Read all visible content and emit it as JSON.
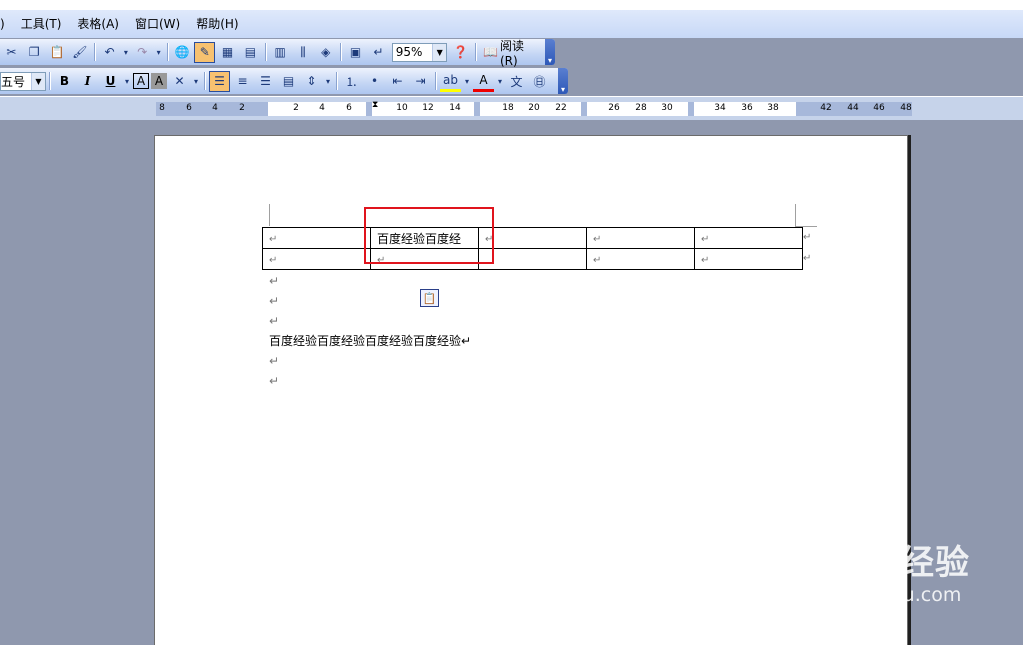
{
  "menu": {
    "items": [
      ")",
      "工具(T)",
      "表格(A)",
      "窗口(W)",
      "帮助(H)"
    ]
  },
  "toolbar1": {
    "zoom": "95%",
    "read_label": "阅读(R)"
  },
  "toolbar2": {
    "font_size": "五号",
    "bold": "B",
    "italic": "I",
    "underline": "U",
    "font_color": "A",
    "char_border": "A",
    "highlight": "A"
  },
  "ruler": {
    "ticks": [
      "8",
      "6",
      "4",
      "2",
      "2",
      "4",
      "6",
      "10",
      "12",
      "14",
      "18",
      "20",
      "22",
      "26",
      "28",
      "30",
      "34",
      "36",
      "38",
      "42",
      "44",
      "46",
      "48"
    ]
  },
  "document": {
    "table": {
      "rows": [
        [
          "↵",
          "百度经验百度经",
          "↵",
          "↵",
          "↵"
        ],
        [
          "↵",
          "↵",
          "",
          "↵",
          "↵"
        ]
      ],
      "row_end_marks": [
        "↵",
        "↵"
      ]
    },
    "paragraphs": [
      "↵",
      "↵",
      "↵",
      "百度经验百度经验百度经验百度经验↵",
      "↵",
      "↵"
    ]
  },
  "watermark": {
    "logo": "Baidu经验",
    "url": "jingyan.baidu.com"
  },
  "colors": {
    "highlight_box": "#e0141d",
    "workspace": "#8f98ae"
  }
}
